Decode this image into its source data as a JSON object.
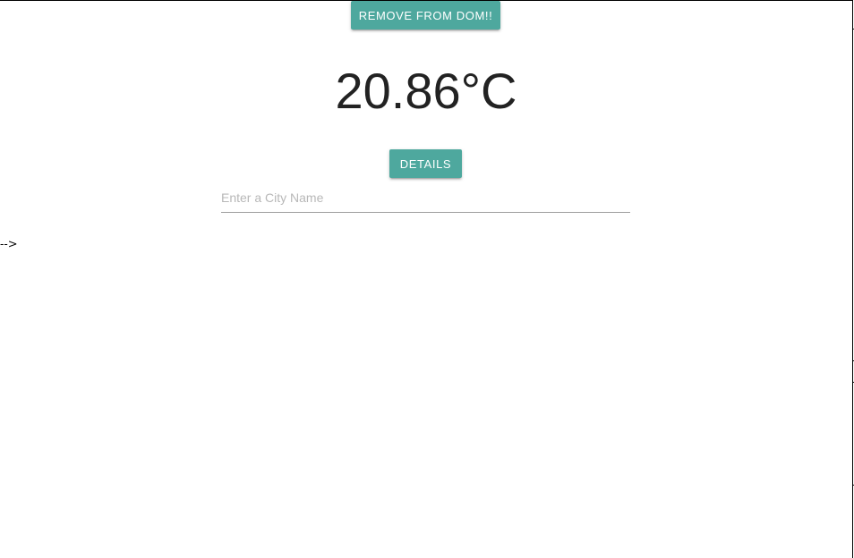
{
  "controls": {
    "remove_label": "REMOVE FROM DOM!!",
    "details_label": "DETAILS"
  },
  "weather": {
    "temperature": "20.86°C"
  },
  "search": {
    "value": "",
    "placeholder": "Enter a City Name"
  },
  "stray_comment_text": "-->",
  "colors": {
    "button_bg": "#4ea89e",
    "button_text": "#ffffff",
    "temperature_text": "#222222",
    "placeholder_text": "#b8b8b8"
  }
}
